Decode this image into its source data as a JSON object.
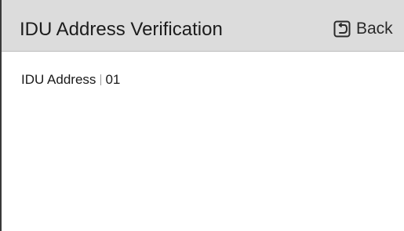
{
  "header": {
    "title": "IDU Address Verification",
    "back_label": "Back",
    "back_icon": "return-arrow-icon",
    "background_color": "#dcdcdc"
  },
  "content": {
    "address_label": "IDU Address",
    "address_value": "01"
  }
}
